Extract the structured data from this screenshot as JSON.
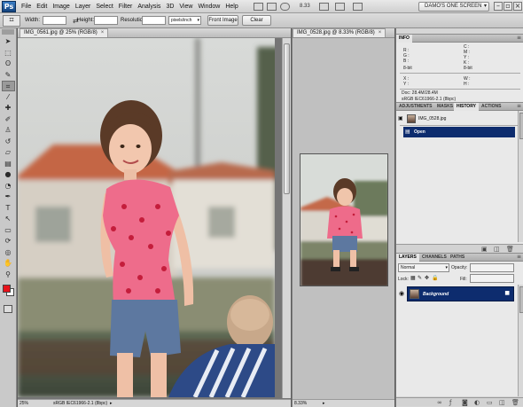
{
  "app": {
    "logo": "Ps"
  },
  "menu": [
    "File",
    "Edit",
    "Image",
    "Layer",
    "Select",
    "Filter",
    "Analysis",
    "3D",
    "View",
    "Window",
    "Help"
  ],
  "menubar": {
    "zoom_readout": "8.33",
    "workspace": "DAMO'S ONE SCREEN"
  },
  "options": {
    "width_label": "Width:",
    "height_label": "Height:",
    "resolution_label": "Resolution:",
    "units_value": "pixels/inch",
    "front_image": "Front Image",
    "clear": "Clear"
  },
  "doc1": {
    "tab": "IMG_0561.jpg @ 25% (RGB/8)",
    "zoom": "25%",
    "profile": "sRGB IEC61966-2.1 (8bpc)"
  },
  "doc2": {
    "tab": "IMG_0528.jpg @ 8.33% (RGB/8)",
    "zoom": "8.33%",
    "profile": "sRGB IEC61966-2.1 (8bpc)"
  },
  "info": {
    "tab": "INFO",
    "r": "R :",
    "g": "G :",
    "b": "B :",
    "bit": "8-bit",
    "c": "C :",
    "m": "M :",
    "y": "Y :",
    "k": "K :",
    "x": "X :",
    "yc": "Y :",
    "w": "W :",
    "h": "H :",
    "doc": "Doc: 28.4M/28.4M",
    "profile": "sRGB IEC61966-2.1 (8bpc)"
  },
  "history": {
    "tabs": [
      "ADJUSTMENTS",
      "MASKS",
      "HISTORY",
      "ACTIONS"
    ],
    "snapshot": "IMG_0528.jpg",
    "states": [
      "Open"
    ]
  },
  "layers": {
    "tabs": [
      "LAYERS",
      "CHANNELS",
      "PATHS"
    ],
    "blend_mode": "Normal",
    "opacity_label": "Opacity:",
    "lock_label": "Lock:",
    "fill_label": "Fill:",
    "layer_name": "Background"
  },
  "colors": {
    "foreground": "#e8131b",
    "background": "#ffffff",
    "selection": "#0d2c6e"
  }
}
